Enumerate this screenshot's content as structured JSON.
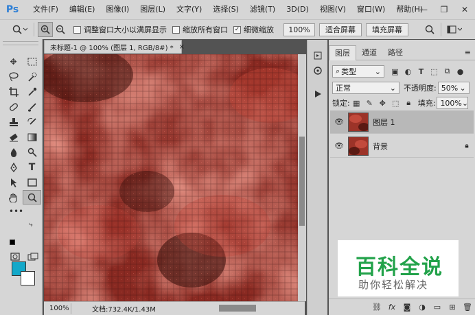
{
  "app": {
    "logo": "Ps"
  },
  "menu": [
    "文件(F)",
    "编辑(E)",
    "图像(I)",
    "图层(L)",
    "文字(Y)",
    "选择(S)",
    "滤镜(T)",
    "3D(D)",
    "视图(V)",
    "窗口(W)",
    "帮助(H)"
  ],
  "window_controls": {
    "minimize": "—",
    "restore": "❐",
    "close": "✕"
  },
  "options": {
    "resize_windows": "调整窗口大小以满屏显示",
    "zoom_all": "缩放所有窗口",
    "scrubby_zoom": "细微缩放",
    "scrubby_checked": "✓",
    "zoom_100": "100%",
    "fit_screen": "适合屏幕",
    "fill_screen": "填充屏幕"
  },
  "document": {
    "tab_title": "未标题-1 @ 100% (图层 1, RGB/8#) *",
    "tab_close": "×",
    "zoom": "100%",
    "doc_size": "文档:732.4K/1.43M",
    "texture_colors": {
      "base": "#8a2a22",
      "light": "#c0463a",
      "dark": "#3f120d"
    }
  },
  "colors": {
    "foreground": "#13a8c9",
    "background": "#ffffff"
  },
  "layers_panel": {
    "tabs": [
      "图层",
      "通道",
      "路径"
    ],
    "filter_kind": "类型",
    "blend_mode": "正常",
    "opacity_label": "不透明度:",
    "opacity_value": "50%",
    "lock_label": "锁定:",
    "fill_label": "填充:",
    "fill_value": "100%",
    "layers": [
      {
        "name": "图层 1",
        "selected": true,
        "locked": false
      },
      {
        "name": "背景",
        "selected": false,
        "locked": true
      }
    ]
  },
  "watermark": {
    "title": "百科全说",
    "subtitle": "助你轻松解决"
  }
}
